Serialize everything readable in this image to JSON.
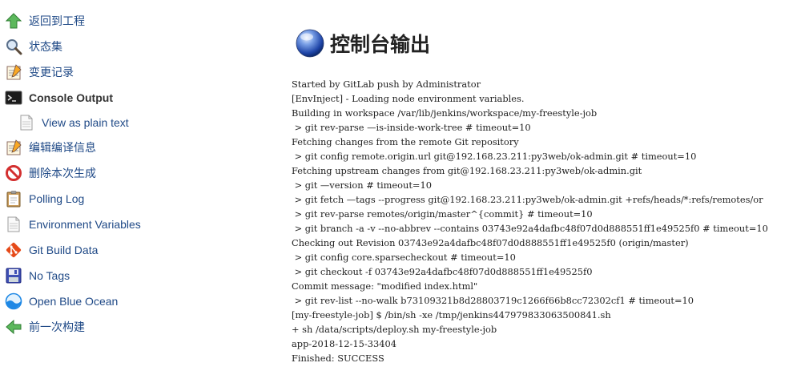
{
  "sidebar": {
    "items": [
      {
        "label": "返回到工程"
      },
      {
        "label": "状态集"
      },
      {
        "label": "变更记录"
      },
      {
        "label": "Console Output"
      },
      {
        "label": "View as plain text"
      },
      {
        "label": "编辑编译信息"
      },
      {
        "label": "删除本次生成"
      },
      {
        "label": "Polling Log"
      },
      {
        "label": "Environment Variables"
      },
      {
        "label": "Git Build Data"
      },
      {
        "label": "No Tags"
      },
      {
        "label": "Open Blue Ocean"
      },
      {
        "label": "前一次构建"
      }
    ]
  },
  "main": {
    "title": "控制台输出",
    "console_lines": [
      "Started by GitLab push by Administrator",
      "[EnvInject] - Loading node environment variables.",
      "Building in workspace /var/lib/jenkins/workspace/my-freestyle-job",
      " > git rev-parse —is-inside-work-tree # timeout=10",
      "Fetching changes from the remote Git repository",
      " > git config remote.origin.url git@192.168.23.211:py3web/ok-admin.git # timeout=10",
      "Fetching upstream changes from git@192.168.23.211:py3web/ok-admin.git",
      " > git —version # timeout=10",
      " > git fetch —tags --progress git@192.168.23.211:py3web/ok-admin.git +refs/heads/*:refs/remotes/or",
      " > git rev-parse remotes/origin/master^{commit} # timeout=10",
      " > git branch -a -v --no-abbrev --contains 03743e92a4dafbc48f07d0d888551ff1e49525f0 # timeout=10",
      "Checking out Revision 03743e92a4dafbc48f07d0d888551ff1e49525f0 (origin/master)",
      " > git config core.sparsecheckout # timeout=10",
      " > git checkout -f 03743e92a4dafbc48f07d0d888551ff1e49525f0",
      "Commit message: \"modified index.html\"",
      " > git rev-list --no-walk b73109321b8d28803719c1266f66b8cc72302cf1 # timeout=10",
      "[my-freestyle-job] $ /bin/sh -xe /tmp/jenkins447979833063500841.sh",
      "+ sh /data/scripts/deploy.sh my-freestyle-job",
      "app-2018-12-15-33404",
      "Finished: SUCCESS"
    ]
  },
  "icons": {
    "back": "up-arrow-icon",
    "status": "magnifier-icon",
    "changes": "notepad-icon",
    "console": "terminal-icon",
    "plain": "document-icon",
    "edit": "notepad-edit-icon",
    "delete": "no-entry-icon",
    "polling": "clipboard-icon",
    "env": "document-icon",
    "git": "git-icon",
    "tags": "floppy-disk-icon",
    "blueocean": "blue-ocean-icon",
    "previous": "left-arrow-icon",
    "title": "blue-orb-icon"
  },
  "colors": {
    "link": "#204a87",
    "text": "#333333",
    "green": "#4caf50",
    "red": "#d32f2f",
    "blue": "#2962c9"
  }
}
